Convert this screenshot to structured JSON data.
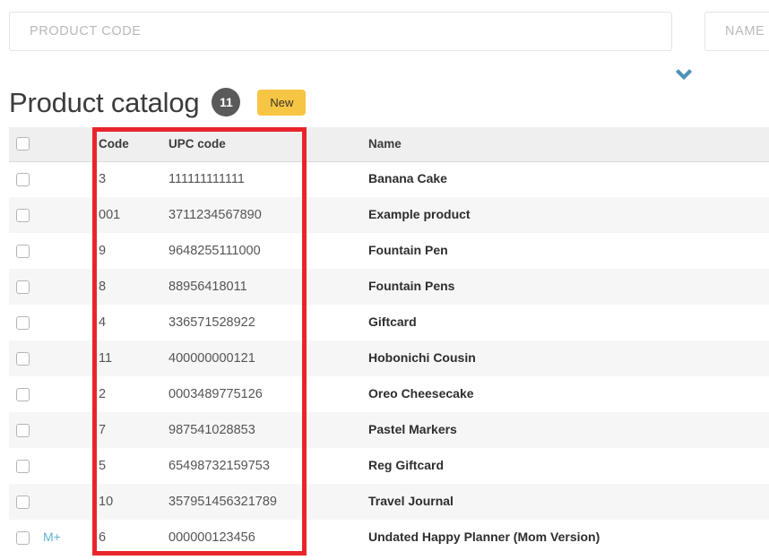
{
  "filters": {
    "product_code": {
      "placeholder": "PRODUCT CODE",
      "value": ""
    },
    "name": {
      "placeholder": "NAME",
      "value": ""
    },
    "expand_icon": "chevron-down-icon"
  },
  "header": {
    "title": "Product catalog",
    "count": "11",
    "new_label": "New"
  },
  "table": {
    "columns": {
      "select": "",
      "mplus": "",
      "code": "Code",
      "upc": "UPC code",
      "name": "Name"
    },
    "rows": [
      {
        "mplus": "",
        "code": "3",
        "upc": "111111111111",
        "name": "Banana Cake"
      },
      {
        "mplus": "",
        "code": "001",
        "upc": "3711234567890",
        "name": "Example product"
      },
      {
        "mplus": "",
        "code": "9",
        "upc": "9648255111000",
        "name": "Fountain Pen"
      },
      {
        "mplus": "",
        "code": "8",
        "upc": "88956418011",
        "name": "Fountain Pens"
      },
      {
        "mplus": "",
        "code": "4",
        "upc": "336571528922",
        "name": "Giftcard"
      },
      {
        "mplus": "",
        "code": "11",
        "upc": "400000000121",
        "name": "Hobonichi Cousin"
      },
      {
        "mplus": "",
        "code": "2",
        "upc": "0003489775126",
        "name": "Oreo Cheesecake"
      },
      {
        "mplus": "",
        "code": "7",
        "upc": "987541028853",
        "name": "Pastel Markers"
      },
      {
        "mplus": "",
        "code": "5",
        "upc": "65498732159753",
        "name": "Reg Giftcard"
      },
      {
        "mplus": "",
        "code": "10",
        "upc": "357951456321789",
        "name": "Travel Journal"
      },
      {
        "mplus": "M+",
        "code": "6",
        "upc": "000000123456",
        "name": "Undated Happy Planner (Mom Version)"
      }
    ]
  },
  "annotation": {
    "color": "#e8252b",
    "covers": [
      "Code",
      "UPC code"
    ]
  }
}
